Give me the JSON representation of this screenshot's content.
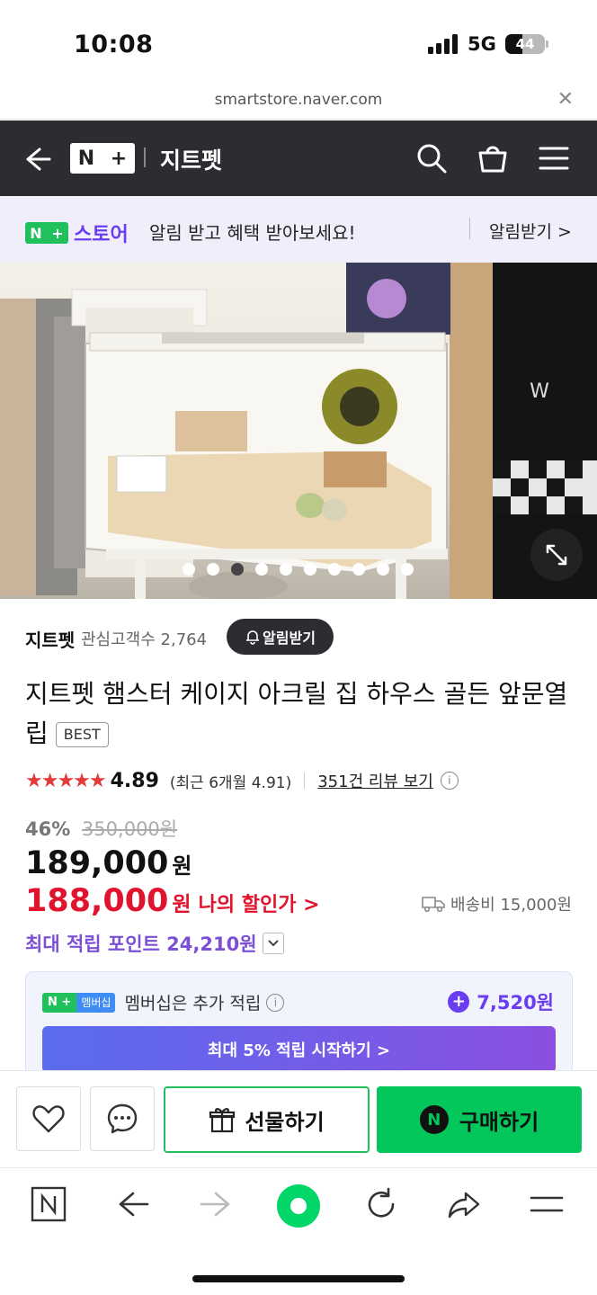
{
  "status": {
    "time": "10:08",
    "network": "5G",
    "battery": "44",
    "battery_level": 0.44
  },
  "browser": {
    "url": "smartstore.naver.com",
    "close_icon": "close-icon"
  },
  "header": {
    "logo_n": "N",
    "logo_plus": "+",
    "store_name": "지트펫"
  },
  "notice": {
    "badge_n": "N",
    "badge_plus": "+",
    "badge_store": "스토어",
    "message": "알림 받고 혜택 받아보세요!",
    "cta": "알림받기 >"
  },
  "hero": {
    "slide_count": 10,
    "active_slide": 3
  },
  "seller": {
    "name": "지트펫",
    "fans": "관심고객수 2,764",
    "alarm_button": "알림받기"
  },
  "product": {
    "title": "지트펫 햄스터 케이지 아크릴 집 하우스 골든 앞문열립",
    "badge": "BEST",
    "rating": "4.89",
    "star_count": 5,
    "recent_rating": "(최근 6개월 4.91)",
    "reviews": "351건 리뷰 보기",
    "discount_pct": "46%",
    "original_price": "350,000원",
    "price": "189,000",
    "price_unit": "원",
    "my_price": "188,000",
    "my_price_unit": "원",
    "my_price_label": "나의 할인가 >",
    "shipping": "배송비 15,000원",
    "points": "최대 적립 포인트 24,210원"
  },
  "membership": {
    "badge_a": "N +",
    "badge_b": "멤버십",
    "text": "멤버십은 추가 적립",
    "extra": "7,520원",
    "cta": "최대 5% 적립 시작하기 >"
  },
  "actions": {
    "gift": "선물하기",
    "buy": "구매하기",
    "buy_logo": "N"
  },
  "colors": {
    "accent_green": "#03c75a",
    "accent_purple": "#6a3df0",
    "sale_red": "#e0142c",
    "header_dark": "#2b2d31"
  }
}
